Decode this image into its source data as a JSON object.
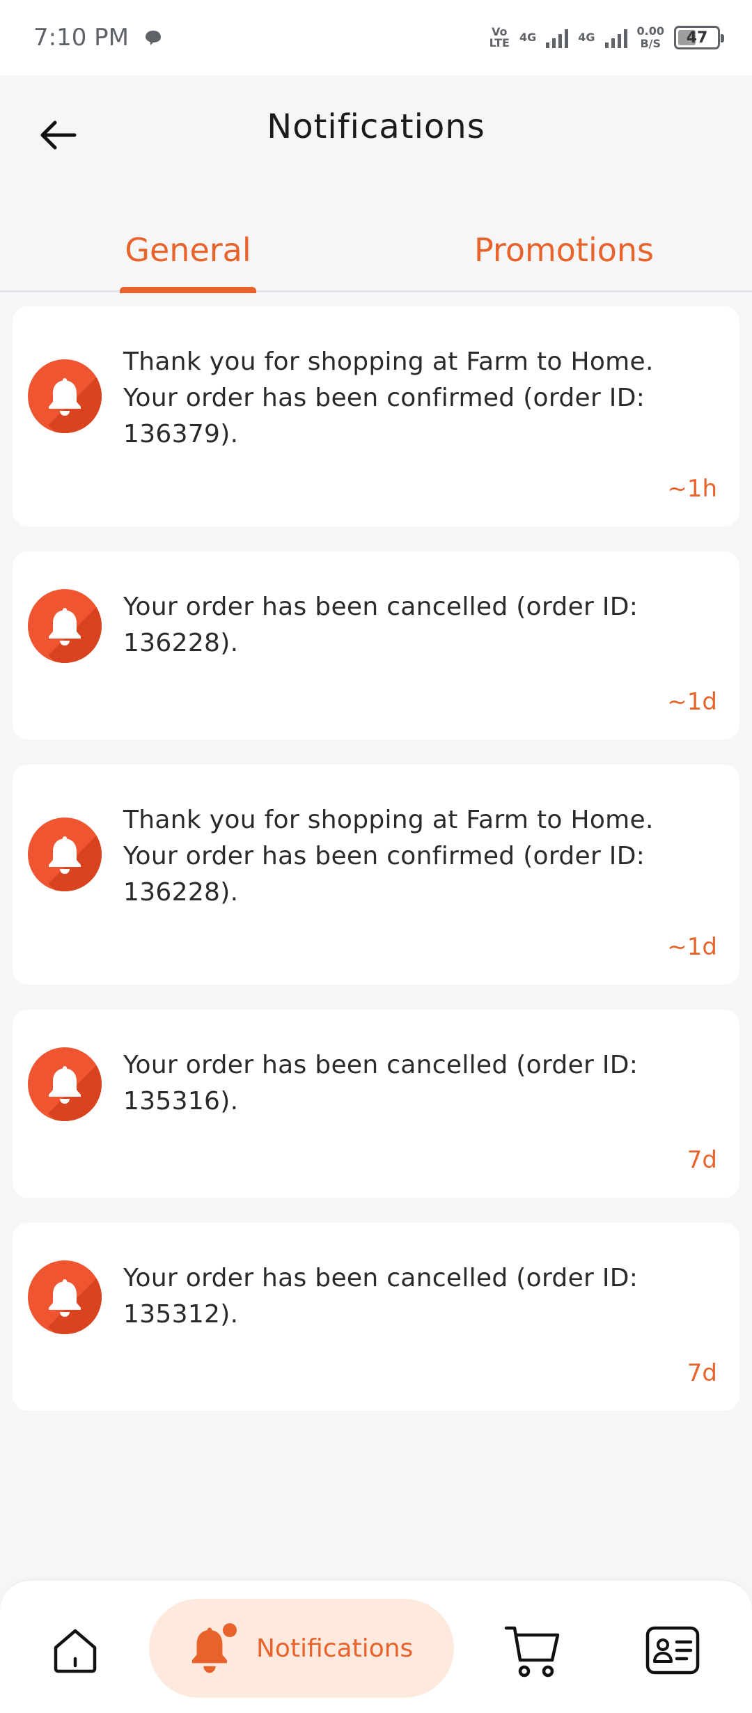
{
  "status_bar": {
    "time": "7:10 PM",
    "volte": "Vo\nLTE",
    "net1": "4G",
    "net2": "4G",
    "speed_value": "0.00",
    "speed_unit": "B/S",
    "battery": "47"
  },
  "header": {
    "title": "Notifications"
  },
  "tabs": [
    {
      "label": "General",
      "selected": true
    },
    {
      "label": "Promotions",
      "selected": false
    }
  ],
  "notifications": [
    {
      "message": "Thank you for shopping at Farm to Home. Your order has been confirmed (order ID: 136379).",
      "time": "~1h"
    },
    {
      "message": "Your order has been cancelled (order ID: 136228).",
      "time": "~1d"
    },
    {
      "message": "Thank you for shopping at Farm to Home. Your order has been confirmed (order ID: 136228).",
      "time": "~1d"
    },
    {
      "message": "Your order has been cancelled (order ID: 135316).",
      "time": "7d"
    },
    {
      "message": "Your order has been cancelled (order ID: 135312).",
      "time": "7d"
    }
  ],
  "bottom_nav": {
    "notifications_label": "Notifications"
  },
  "icons": {
    "back": "arrow-left-icon",
    "bell": "bell-icon",
    "home": "home-icon",
    "cart": "cart-icon",
    "profile": "profile-card-icon"
  },
  "colors": {
    "accent": "#e8632b",
    "bell_circle": "#ee5530",
    "nav_pill": "#fde9dd"
  }
}
